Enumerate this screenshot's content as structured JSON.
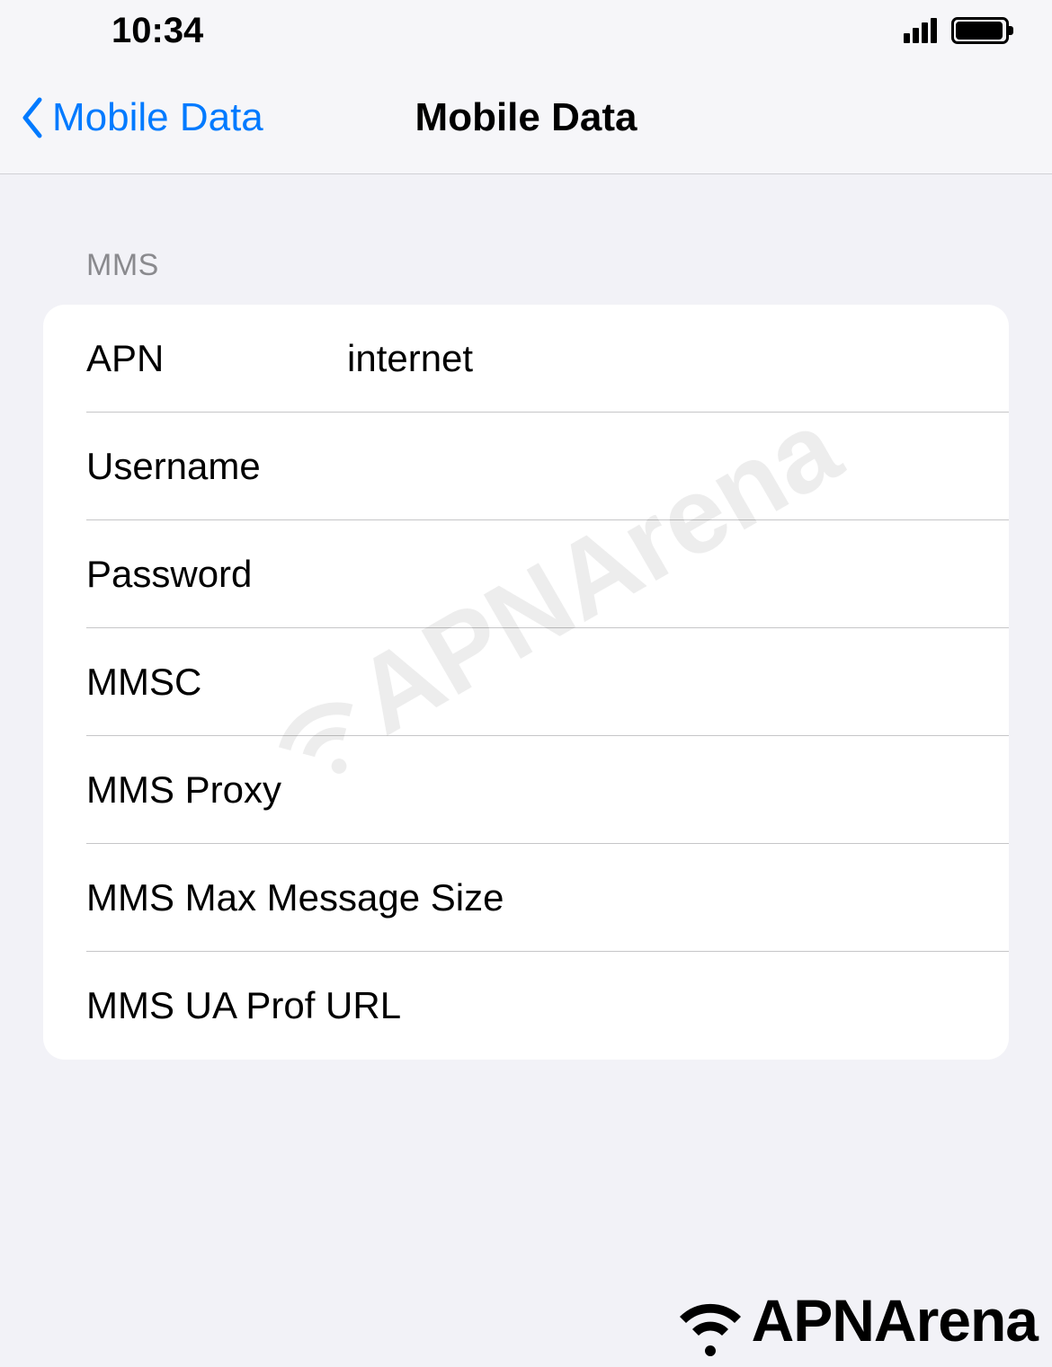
{
  "status_bar": {
    "time": "10:34"
  },
  "nav": {
    "back_label": "Mobile Data",
    "title": "Mobile Data"
  },
  "section_header": "MMS",
  "fields": {
    "apn": {
      "label": "APN",
      "value": "internet"
    },
    "username": {
      "label": "Username",
      "value": ""
    },
    "password": {
      "label": "Password",
      "value": ""
    },
    "mmsc": {
      "label": "MMSC",
      "value": ""
    },
    "mms_proxy": {
      "label": "MMS Proxy",
      "value": ""
    },
    "mms_max_size": {
      "label": "MMS Max Message Size",
      "value": ""
    },
    "mms_ua_prof": {
      "label": "MMS UA Prof URL",
      "value": ""
    }
  },
  "watermark": "APNArena",
  "footer_logo": "APNArena"
}
